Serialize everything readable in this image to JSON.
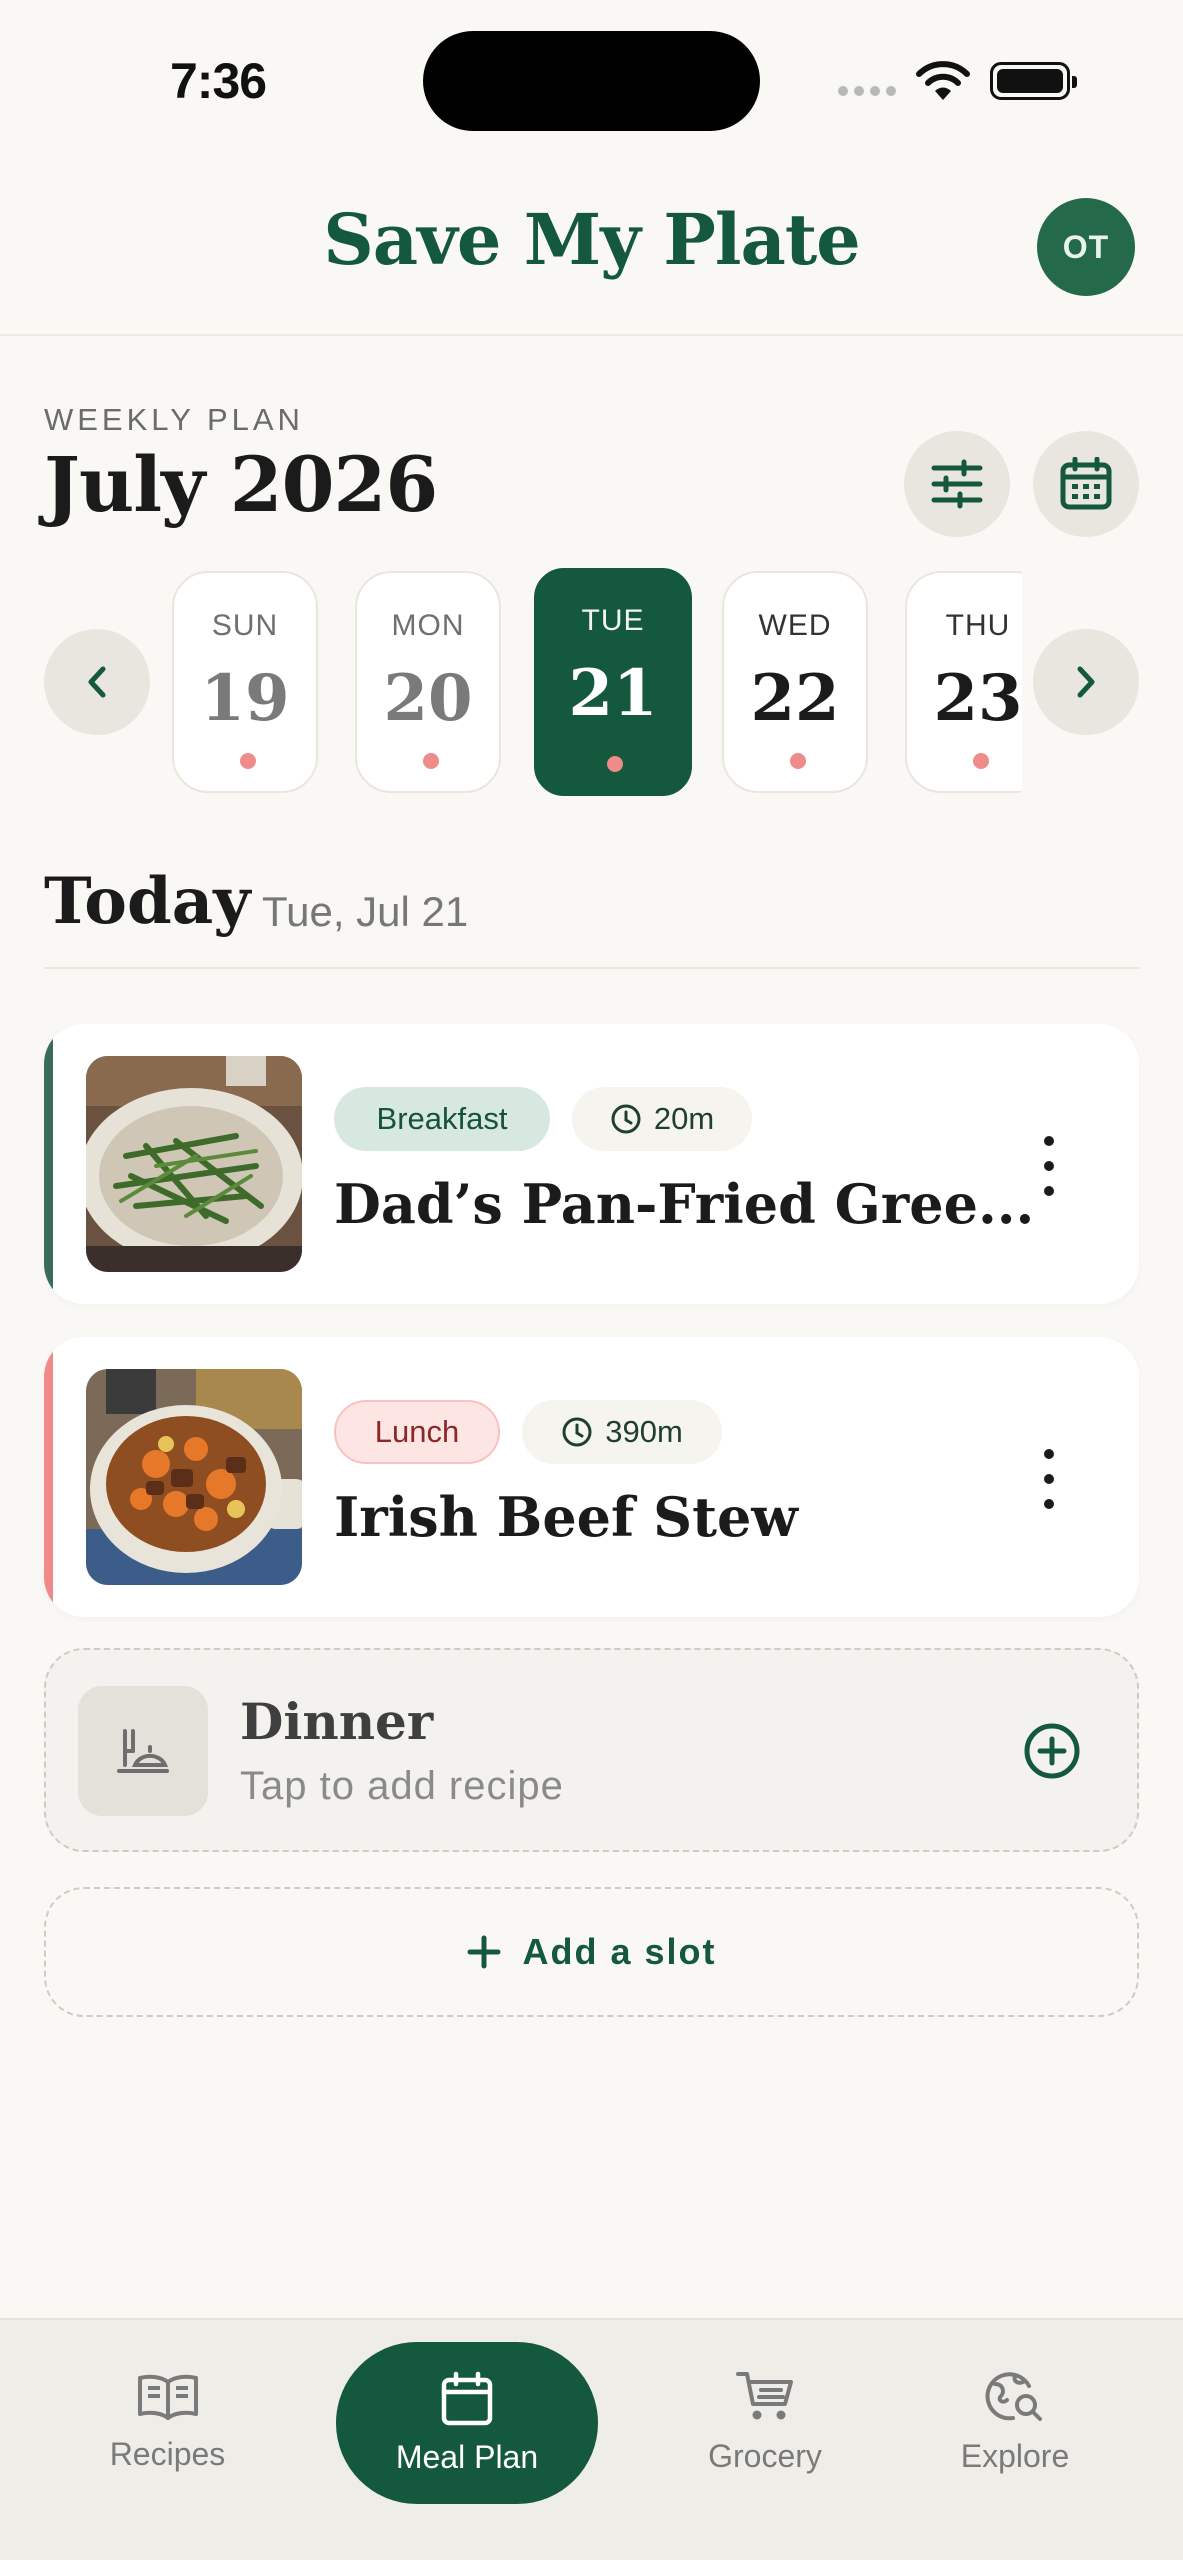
{
  "status_bar": {
    "time": "7:36"
  },
  "header": {
    "title": "Save My Plate",
    "avatar_initials": "OT"
  },
  "plan": {
    "label": "WEEKLY PLAN",
    "month": "July 2026"
  },
  "days": [
    {
      "dow": "SUN",
      "num": "19",
      "state": "past"
    },
    {
      "dow": "MON",
      "num": "20",
      "state": "past"
    },
    {
      "dow": "TUE",
      "num": "21",
      "state": "selected"
    },
    {
      "dow": "WED",
      "num": "22",
      "state": "future"
    },
    {
      "dow": "THU",
      "num": "23",
      "state": "future"
    }
  ],
  "today": {
    "title": "Today",
    "date": "Tue, Jul 21"
  },
  "meals": [
    {
      "slot": "Breakfast",
      "time": "20m",
      "title": "Dad’s Pan-Fried Gree...",
      "accent": "#3B6B5A"
    },
    {
      "slot": "Lunch",
      "time": "390m",
      "title": "Irish Beef Stew",
      "accent": "#F08A8A"
    }
  ],
  "dinner": {
    "title": "Dinner",
    "hint": "Tap to add recipe"
  },
  "add_slot": {
    "label": "Add a slot"
  },
  "nav": {
    "recipes": "Recipes",
    "meal_plan": "Meal Plan",
    "grocery": "Grocery",
    "explore": "Explore",
    "active": "Meal Plan"
  },
  "colors": {
    "brand": "#14583D",
    "background": "#FAF8F4",
    "dot": "#EE8C89"
  }
}
